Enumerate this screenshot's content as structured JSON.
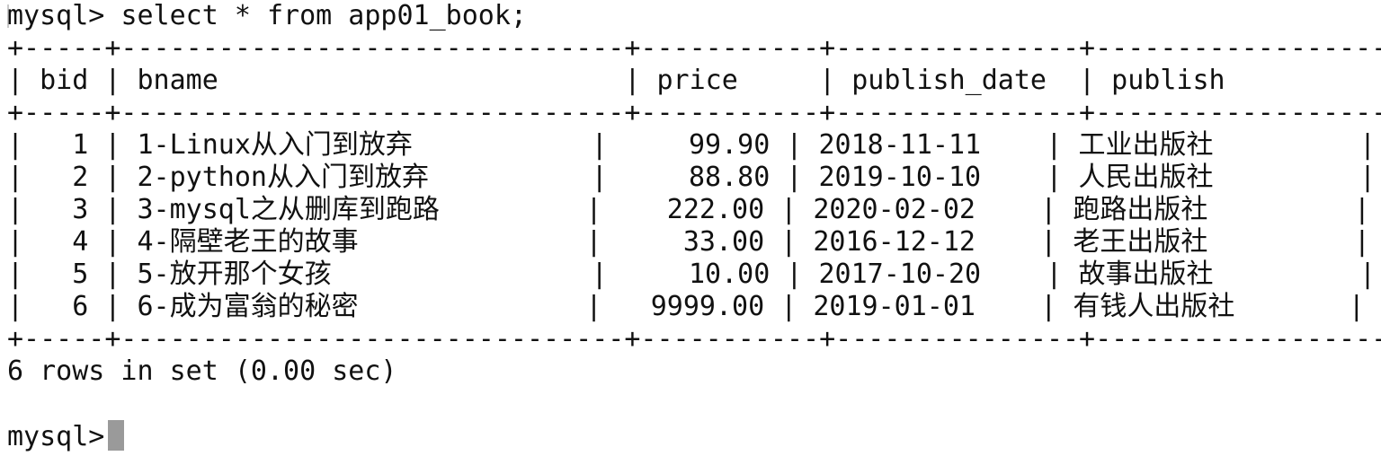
{
  "prompt": "mysql>",
  "command": "select * from app01_book;",
  "table": {
    "border_top": "+-----+-------------------------------+-----------+---------------+--------------------+",
    "columns_line": "| bid | bname                         | price     | publish_date  | publish            |",
    "border_mid": "+-----+-------------------------------+-----------+---------------+--------------------+",
    "rows": [
      "|   1 | 1-Linux从入门到放弃           |     99.90 | 2018-11-11    | 工业出版社         |",
      "|   2 | 2-python从入门到放弃          |     88.80 | 2019-10-10    | 人民出版社         |",
      "|   3 | 3-mysql之从删库到跑路         |    222.00 | 2020-02-02    | 跑路出版社         |",
      "|   4 | 4-隔壁老王的故事              |     33.00 | 2016-12-12    | 老王出版社         |",
      "|   5 | 5-放开那个女孩                |     10.00 | 2017-10-20    | 故事出版社         |",
      "|   6 | 6-成为富翁的秘密              |   9999.00 | 2019-01-01    | 有钱人出版社       |"
    ],
    "border_bottom": "+-----+-------------------------------+-----------+---------------+--------------------+"
  },
  "result_summary": "6 rows in set (0.00 sec)",
  "final_prompt": "mysql>"
}
